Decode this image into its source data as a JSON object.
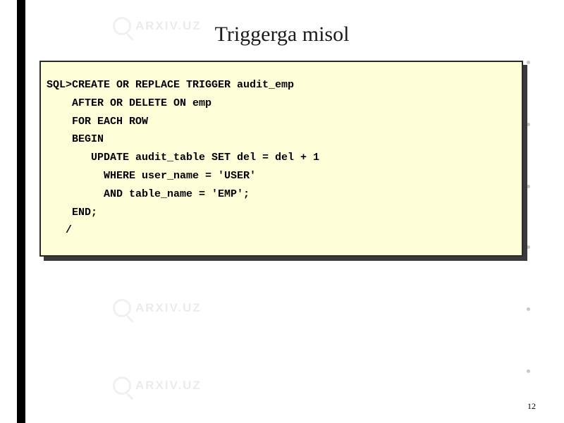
{
  "title": "Triggerga misol",
  "code": {
    "line1": "SQL>CREATE OR REPLACE TRIGGER audit_emp",
    "line2": "    AFTER OR DELETE ON emp",
    "line3": "    FOR EACH ROW",
    "line4": "    BEGIN",
    "line5": "       UPDATE audit_table SET del = del + 1",
    "line6": "         WHERE user_name = 'USER'",
    "line7": "         AND table_name = 'EMP';",
    "line8": "    END;",
    "line9": "   /"
  },
  "watermark": "ARXIV.UZ",
  "page_number": "12"
}
